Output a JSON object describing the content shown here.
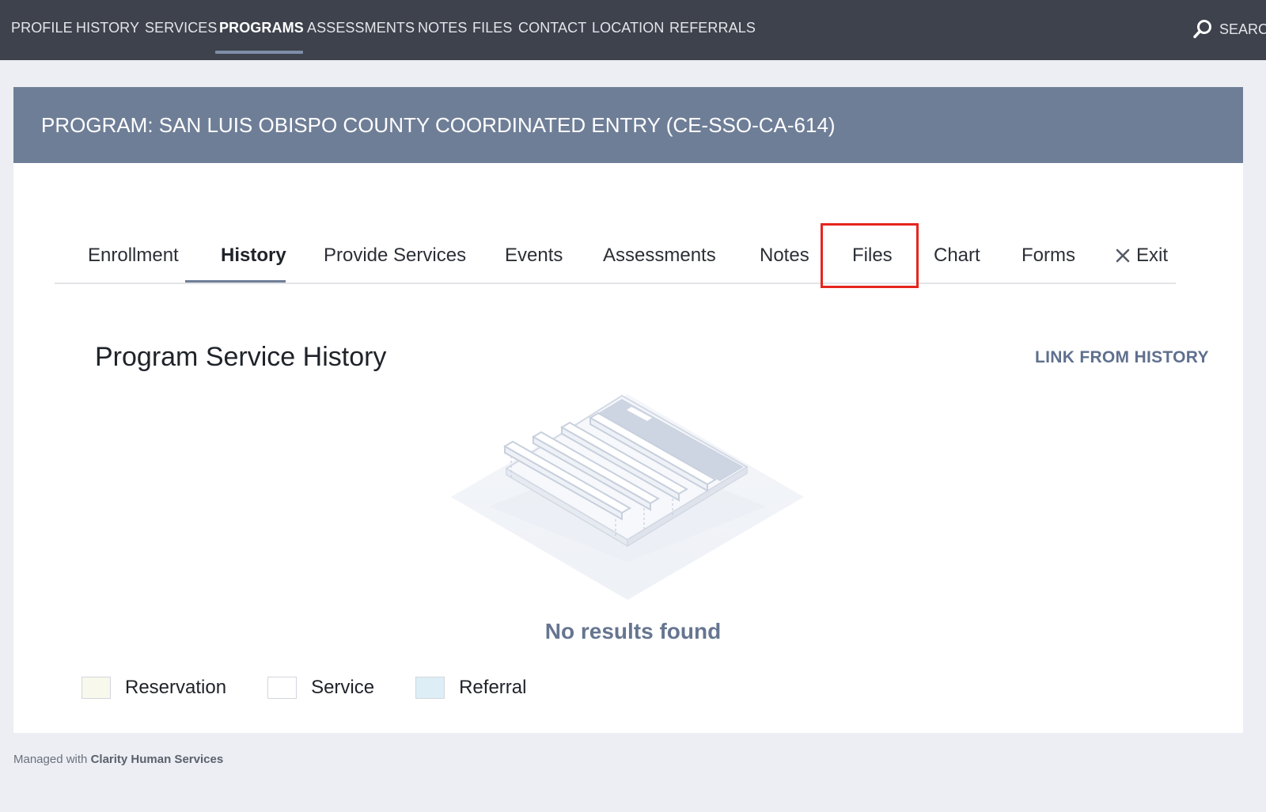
{
  "topnav": {
    "items": [
      "PROFILE",
      "HISTORY",
      "SERVICES",
      "PROGRAMS",
      "ASSESSMENTS",
      "NOTES",
      "FILES",
      "CONTACT",
      "LOCATION",
      "REFERRALS"
    ],
    "active": "PROGRAMS",
    "search_label": "SEARC",
    "search_icon": "search-icon"
  },
  "program": {
    "title": "PROGRAM: SAN LUIS OBISPO COUNTY COORDINATED ENTRY (CE-SSO-CA-614)"
  },
  "subtabs": {
    "items": [
      "Enrollment",
      "History",
      "Provide Services",
      "Events",
      "Assessments",
      "Notes",
      "Files",
      "Chart",
      "Forms"
    ],
    "active": "History",
    "exit_label": "Exit",
    "exit_icon": "close-icon"
  },
  "section": {
    "title": "Program Service History",
    "link_label": "LINK FROM HISTORY",
    "empty_text": "No results found"
  },
  "legend": {
    "items": [
      {
        "label": "Reservation",
        "color": "#f8f8ec"
      },
      {
        "label": "Service",
        "color": "#ffffff"
      },
      {
        "label": "Referral",
        "color": "#ddeef6"
      }
    ]
  },
  "footer": {
    "prefix": "Managed with",
    "brand": "Clarity Human Services"
  },
  "colors": {
    "nav_bg": "#3e424c",
    "header_bg": "#6f7e97",
    "accent": "#6f7e97",
    "highlight": "#e5261f"
  }
}
